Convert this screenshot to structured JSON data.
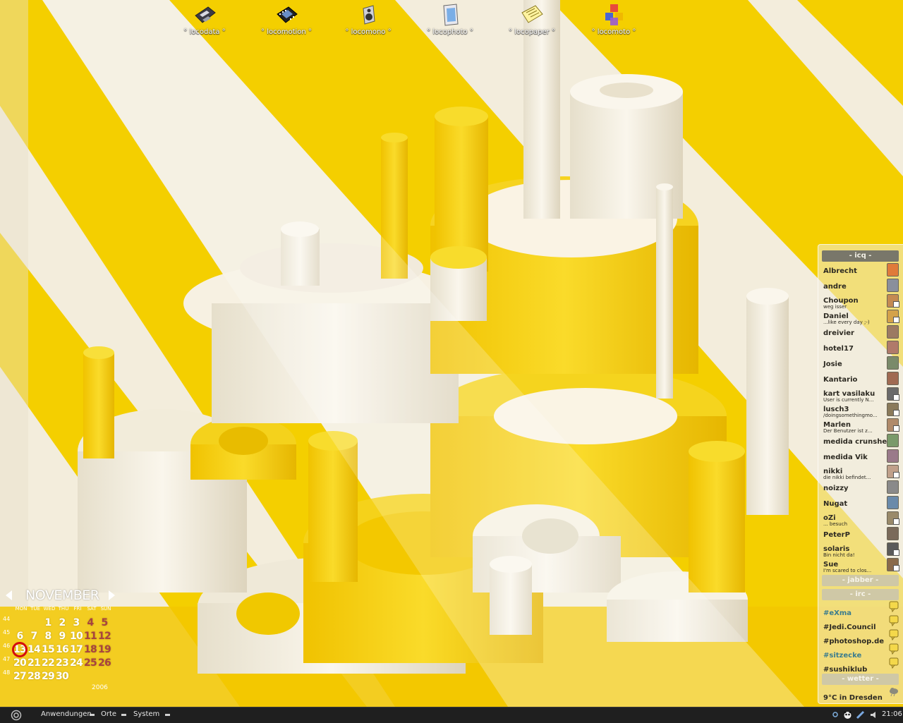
{
  "desktop_icons": [
    {
      "label": "° locodata °",
      "icon": "floppy-disk-icon"
    },
    {
      "label": "° locomotion °",
      "icon": "film-strip-icon"
    },
    {
      "label": "° locomono °",
      "icon": "speaker-icon"
    },
    {
      "label": "° locophoto °",
      "icon": "picture-frame-icon"
    },
    {
      "label": "° locopaper °",
      "icon": "paper-note-icon"
    },
    {
      "label": "° locomoto °",
      "icon": "cubes-icon"
    }
  ],
  "calendar": {
    "month": "NOVEMBER",
    "year": "2006",
    "weekday_labels": [
      "MON",
      "TUE",
      "WED",
      "THU",
      "FRI",
      "SAT",
      "SUN"
    ],
    "weeks": [
      {
        "week": "44",
        "days": [
          "",
          "",
          "1",
          "2",
          "3",
          "4",
          "5"
        ]
      },
      {
        "week": "45",
        "days": [
          "6",
          "7",
          "8",
          "9",
          "10",
          "11",
          "12"
        ]
      },
      {
        "week": "46",
        "days": [
          "13",
          "14",
          "15",
          "16",
          "17",
          "18",
          "19"
        ]
      },
      {
        "week": "47",
        "days": [
          "20",
          "21",
          "22",
          "23",
          "24",
          "25",
          "26"
        ]
      },
      {
        "week": "48",
        "days": [
          "27",
          "28",
          "29",
          "30",
          "",
          "",
          ""
        ]
      }
    ],
    "today": "13",
    "weekend_color": "#a8433f",
    "today_ring_color": "#d40d0d"
  },
  "buddy_panel": {
    "icq_header": "- icq -",
    "jabber_header": "- jabber -",
    "irc_header": "- irc -",
    "wetter_header": "- wetter -",
    "contacts": [
      {
        "name": "Albrecht",
        "status": ""
      },
      {
        "name": "andre",
        "status": ""
      },
      {
        "name": "Choupon",
        "status": "weg isser"
      },
      {
        "name": "Daniel",
        "status": "...like every day ;-)"
      },
      {
        "name": "dreivier",
        "status": ""
      },
      {
        "name": "hotel17",
        "status": ""
      },
      {
        "name": "Josie",
        "status": ""
      },
      {
        "name": "Kantario",
        "status": ""
      },
      {
        "name": "kart vasilaku",
        "status": "User is currently N..."
      },
      {
        "name": "lusch3",
        "status": "/doingsomethingmo..."
      },
      {
        "name": "Marlen",
        "status": "Der Benutzer ist z..."
      },
      {
        "name": "medida crunsher",
        "status": ""
      },
      {
        "name": "medida Vik",
        "status": ""
      },
      {
        "name": "nikki",
        "status": "die nikki befindet..."
      },
      {
        "name": "noizzy",
        "status": ""
      },
      {
        "name": "Nugat",
        "status": ""
      },
      {
        "name": "oZi",
        "status": "... besuch"
      },
      {
        "name": "PeterP",
        "status": ""
      },
      {
        "name": "solaris",
        "status": "Bin nicht da!"
      },
      {
        "name": "Sue",
        "status": "I'm scared to clos..."
      }
    ],
    "channels": [
      {
        "name": "#eXma",
        "highlight": true
      },
      {
        "name": "#Jedi.Council",
        "highlight": false
      },
      {
        "name": "#photoshop.de",
        "highlight": false
      },
      {
        "name": "#sitzecke",
        "highlight": true
      },
      {
        "name": "#sushiklub",
        "highlight": false
      }
    ],
    "weather": "9°C in Dresden"
  },
  "taskbar": {
    "menus": [
      "Anwendungen",
      "Orte",
      "System"
    ],
    "clock": "21:06"
  },
  "colors": {
    "wallpaper_yellow": "#f4cf00",
    "wallpaper_cream": "#f3eddc",
    "taskbar": "#1f1f1f"
  }
}
